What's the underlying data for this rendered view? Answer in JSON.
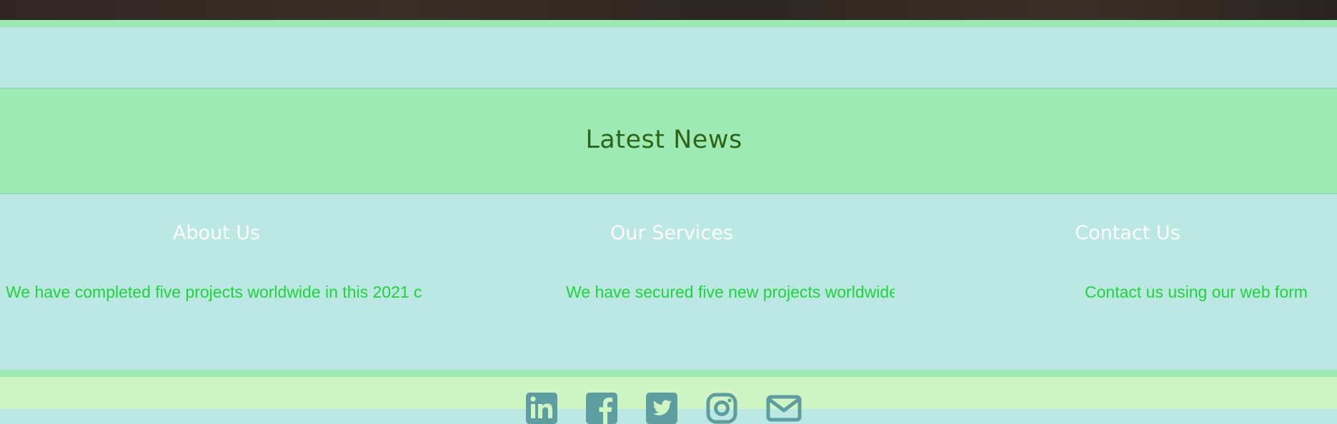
{
  "news": {
    "title": "Latest News"
  },
  "columns": [
    {
      "heading": "About Us",
      "text": "We have completed five projects worldwide in this 2021 c"
    },
    {
      "heading": "Our Services",
      "text": "We have secured five new projects worldwide"
    },
    {
      "heading": "Contact Us",
      "text": "Contact us using our web form"
    }
  ],
  "footer": {
    "social_icons": [
      "linkedin-icon",
      "facebook-icon",
      "twitter-icon",
      "instagram-icon",
      "email-icon"
    ]
  },
  "colors": {
    "news_band": "#9deab4",
    "info_band": "#bbe8e2",
    "news_title": "#2e6417",
    "link_text": "#1ed33b",
    "icon": "#5f9ea0",
    "footer": "#d0f5c4"
  }
}
